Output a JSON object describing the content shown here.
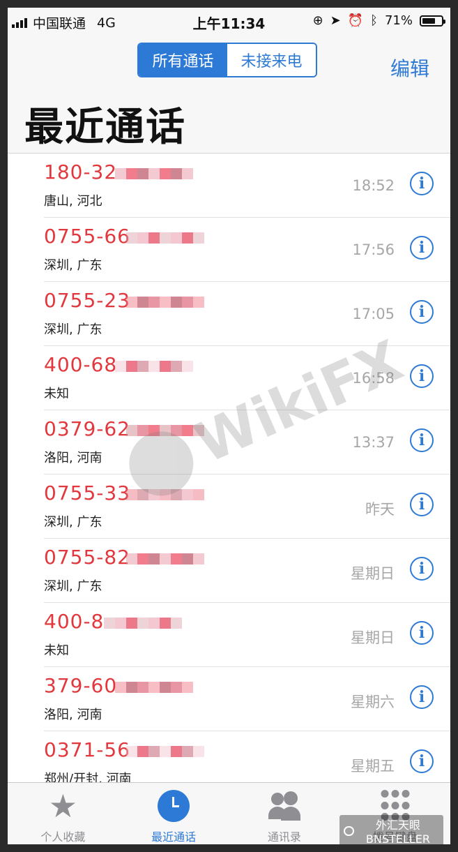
{
  "status_bar": {
    "carrier": "中国联通",
    "network": "4G",
    "time": "上午11:34",
    "battery_percent": "71%",
    "battery_level": 0.71
  },
  "header": {
    "segment_all": "所有通话",
    "segment_missed": "未接来电",
    "edit_label": "编辑",
    "title": "最近通话"
  },
  "calls": [
    {
      "number": "180-32",
      "location": "唐山, 河北",
      "time": "18:52"
    },
    {
      "number": "0755-66",
      "location": "深圳, 广东",
      "time": "17:56"
    },
    {
      "number": "0755-23",
      "location": "深圳, 广东",
      "time": "17:05"
    },
    {
      "number": "400-68",
      "location": "未知",
      "time": "16:58"
    },
    {
      "number": "0379-62",
      "location": "洛阳, 河南",
      "time": "13:37"
    },
    {
      "number": "0755-33",
      "location": "深圳, 广东",
      "time": "昨天"
    },
    {
      "number": "0755-82",
      "location": "深圳, 广东",
      "time": "星期日"
    },
    {
      "number": "400-8",
      "location": "未知",
      "time": "星期日"
    },
    {
      "number": "379-60",
      "location": "洛阳, 河南",
      "time": "星期六"
    },
    {
      "number": "0371-56",
      "location": "郑州/开封, 河南",
      "time": "星期五"
    }
  ],
  "watermark": "WikiFX",
  "tabs": {
    "favorites": "个人收藏",
    "recents": "最近通话",
    "contacts": "通讯录",
    "keypad": "拨号键盘"
  },
  "wechat_mark": "外汇天眼BNSTELLER",
  "colors": {
    "accent": "#2d7ad6",
    "number_red": "#e2383d",
    "time_gray": "#a6a6a6"
  }
}
